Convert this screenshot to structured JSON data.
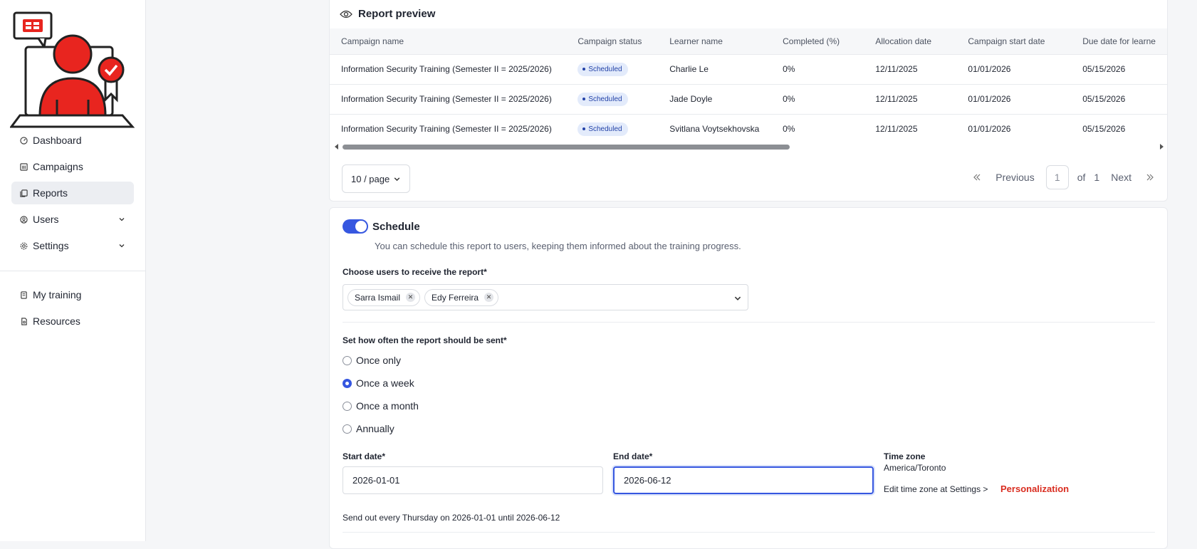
{
  "sidebar": {
    "nav": [
      {
        "label": "Dashboard",
        "icon": "dashboard-icon"
      },
      {
        "label": "Campaigns",
        "icon": "campaigns-icon"
      },
      {
        "label": "Reports",
        "icon": "reports-icon",
        "active": true
      },
      {
        "label": "Users",
        "icon": "users-icon",
        "expandable": true
      },
      {
        "label": "Settings",
        "icon": "settings-icon",
        "expandable": true
      }
    ],
    "nav2": [
      {
        "label": "My training",
        "icon": "training-icon"
      },
      {
        "label": "Resources",
        "icon": "resources-icon"
      }
    ]
  },
  "preview": {
    "title": "Report preview",
    "columns": [
      "Campaign name",
      "Campaign status",
      "Learner name",
      "Completed (%)",
      "Allocation date",
      "Campaign start date",
      "Due date for learne"
    ],
    "rows": [
      [
        "Information Security Training (Semester II = 2025/2026)",
        "Scheduled",
        "Charlie Le",
        "0%",
        "12/11/2025",
        "01/01/2026",
        "05/15/2026"
      ],
      [
        "Information Security Training (Semester II = 2025/2026)",
        "Scheduled",
        "Jade Doyle",
        "0%",
        "12/11/2025",
        "01/01/2026",
        "05/15/2026"
      ],
      [
        "Information Security Training (Semester II = 2025/2026)",
        "Scheduled",
        "Svitlana Voytsekhovska",
        "0%",
        "12/11/2025",
        "01/01/2026",
        "05/15/2026"
      ]
    ],
    "page_size": "10 / page",
    "pager": {
      "previous": "Previous",
      "page": "1",
      "of": "of",
      "total": "1",
      "next": "Next"
    }
  },
  "schedule": {
    "title": "Schedule",
    "enabled": true,
    "description": "You can schedule this report to users, keeping them informed about the training progress.",
    "recipients_label": "Choose users to receive the report*",
    "recipients": [
      "Sarra Ismail",
      "Edy Ferreira"
    ],
    "frequency_label": "Set how often the report should be sent*",
    "frequency_options": [
      "Once only",
      "Once a week",
      "Once a month",
      "Annually"
    ],
    "frequency_selected": "Once a week",
    "start_label": "Start date*",
    "start_value": "2026-01-01",
    "end_label": "End date*",
    "end_value": "2026-06-12",
    "tz_label": "Time zone",
    "tz_value": "America/Toronto",
    "tz_edit": "Edit time zone at Settings >",
    "tz_link": "Personalization",
    "summary": "Send out every Thursday on 2026-01-01 until 2026-06-12"
  },
  "colors": {
    "accent": "#3657e0",
    "brand_red": "#e8251f",
    "link_red": "#d92d20",
    "badge_bg": "#e3ebfb"
  }
}
